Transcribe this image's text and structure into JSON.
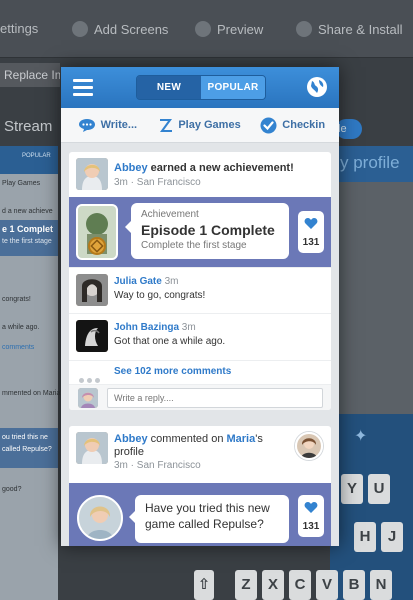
{
  "background": {
    "toolbar": {
      "settings_label": "ettings",
      "add_screens_label": "Add Screens",
      "preview_label": "Preview",
      "share_install_label": "Share & Install"
    },
    "replace_label": "Replace Im",
    "stream_label": "Stream",
    "profile_label": "y profile",
    "left_preview": {
      "tab_popular": "POPULAR",
      "play_games": "Play Games",
      "new_achievement": "d a new achieve",
      "episode": "e 1 Complet",
      "first_stage": "te the first stage",
      "congrats": "congrats!",
      "while_ago": "a while ago.",
      "comments_link": "comments",
      "commented": "mmented on Maria's",
      "repulse": "ou tried this ne",
      "called_repulse": "called Repulse?",
      "good": "good?"
    },
    "keyboard": {
      "row1": [
        "Y",
        "U"
      ],
      "row2": [
        "H",
        "J"
      ],
      "row3": [
        "Z",
        "X",
        "C",
        "V",
        "B",
        "N"
      ]
    }
  },
  "app": {
    "tabs": [
      {
        "label": "NEW"
      },
      {
        "label": "POPULAR"
      }
    ],
    "actions": {
      "write": "Write...",
      "play_games": "Play Games",
      "checkin": "Checkin"
    },
    "colors": {
      "accent": "#2f7ac9",
      "band": "#6b78b7",
      "header": "#3383d0"
    }
  },
  "feed": {
    "post1": {
      "user": "Abbey",
      "action": " earned a new achievement!",
      "meta": "3m · San Francisco",
      "achievement": {
        "kicker": "Achievement",
        "title": "Episode 1 Complete",
        "subtitle": "Complete the first stage",
        "likes": "131"
      },
      "comments": [
        {
          "user": "Julia Gate",
          "time": "3m",
          "body": "Way to go, congrats!"
        },
        {
          "user": "John Bazinga",
          "time": "3m",
          "body": "Got that one a while ago."
        }
      ],
      "more_comments": "See 102 more comments",
      "reply_placeholder": "Write a reply...."
    },
    "post2": {
      "user": "Abbey",
      "verb": " commented on ",
      "target": "Maria",
      "suffix": "'s profile",
      "meta": "3m · San Francisco",
      "message": "Have you tried this new game called Repulse?",
      "likes": "131"
    }
  }
}
